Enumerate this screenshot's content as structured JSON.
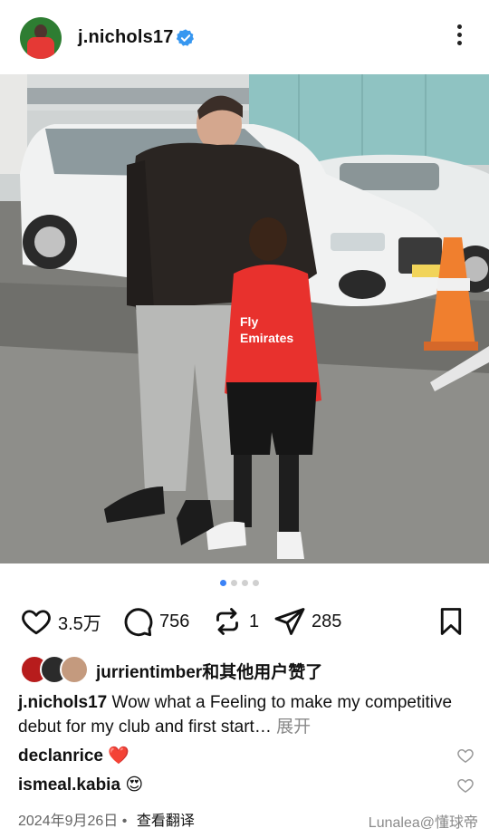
{
  "header": {
    "username": "j.nichols17",
    "more_icon": "more-vertical-icon"
  },
  "carousel": {
    "count": 4,
    "active_index": 0
  },
  "actions": {
    "likes": "3.5万",
    "comments": "756",
    "reposts": "1",
    "shares": "285"
  },
  "liked_by": {
    "text": "jurrientimber和其他用户赞了"
  },
  "caption": {
    "user": "j.nichols17",
    "text": "Wow what a Feeling to make my competitive debut for my club and first start…",
    "more": "展开"
  },
  "comments": [
    {
      "user": "declanrice",
      "emoji": "❤️"
    },
    {
      "user": "ismeal.kabia",
      "emoji": "😍"
    }
  ],
  "footer": {
    "date": "2024年9月26日",
    "separator": "•",
    "translate": "查看翻译",
    "watermark": "Lunalea@懂球帝"
  },
  "colors": {
    "verified": "#3797f0",
    "active_dot": "#3b82f6",
    "heart": "#e0245e"
  }
}
